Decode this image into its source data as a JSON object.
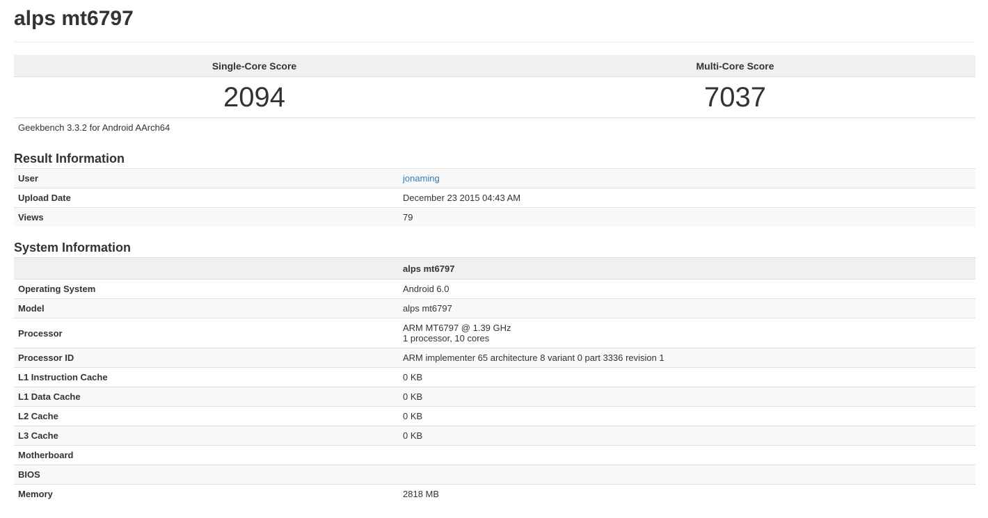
{
  "page": {
    "title": "alps mt6797"
  },
  "scores": {
    "single_label": "Single-Core Score",
    "multi_label": "Multi-Core Score",
    "single_value": "2094",
    "multi_value": "7037",
    "version": "Geekbench 3.3.2 for Android AArch64"
  },
  "result_info": {
    "title": "Result Information",
    "rows": [
      {
        "label": "User",
        "value": "jonaming"
      },
      {
        "label": "Upload Date",
        "value": "December 23 2015 04:43 AM"
      },
      {
        "label": "Views",
        "value": "79"
      }
    ]
  },
  "system_info": {
    "title": "System Information",
    "header": "alps mt6797",
    "rows": [
      {
        "label": "Operating System",
        "value": "Android 6.0"
      },
      {
        "label": "Model",
        "value": "alps mt6797"
      },
      {
        "label": "Processor",
        "value": "ARM MT6797 @ 1.39 GHz",
        "value2": "1 processor, 10 cores"
      },
      {
        "label": "Processor ID",
        "value": "ARM implementer 65 architecture 8 variant 0 part 3336 revision 1"
      },
      {
        "label": "L1 Instruction Cache",
        "value": "0 KB"
      },
      {
        "label": "L1 Data Cache",
        "value": "0 KB"
      },
      {
        "label": "L2 Cache",
        "value": "0 KB"
      },
      {
        "label": "L3 Cache",
        "value": "0 KB"
      },
      {
        "label": "Motherboard",
        "value": ""
      },
      {
        "label": "BIOS",
        "value": ""
      },
      {
        "label": "Memory",
        "value": "2818 MB"
      }
    ]
  },
  "colors": {
    "link": "#337ab7",
    "header_bg": "#f0f0f0",
    "stripe_bg": "#f9f9f9",
    "border": "#dddddd",
    "text": "#333333"
  }
}
